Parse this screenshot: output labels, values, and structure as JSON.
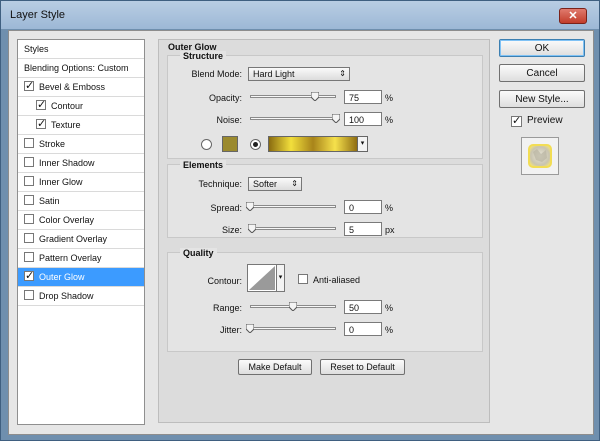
{
  "window": {
    "title": "Layer Style",
    "close_glyph": "✕"
  },
  "styles_list": {
    "items": [
      {
        "label": "Styles",
        "checkbox": false,
        "checked": false,
        "indent": false,
        "selected": false
      },
      {
        "label": "Blending Options: Custom",
        "checkbox": false,
        "checked": false,
        "indent": false,
        "selected": false
      },
      {
        "label": "Bevel & Emboss",
        "checkbox": true,
        "checked": true,
        "indent": false,
        "selected": false
      },
      {
        "label": "Contour",
        "checkbox": true,
        "checked": true,
        "indent": true,
        "selected": false
      },
      {
        "label": "Texture",
        "checkbox": true,
        "checked": true,
        "indent": true,
        "selected": false
      },
      {
        "label": "Stroke",
        "checkbox": true,
        "checked": false,
        "indent": false,
        "selected": false
      },
      {
        "label": "Inner Shadow",
        "checkbox": true,
        "checked": false,
        "indent": false,
        "selected": false
      },
      {
        "label": "Inner Glow",
        "checkbox": true,
        "checked": false,
        "indent": false,
        "selected": false
      },
      {
        "label": "Satin",
        "checkbox": true,
        "checked": false,
        "indent": false,
        "selected": false
      },
      {
        "label": "Color Overlay",
        "checkbox": true,
        "checked": false,
        "indent": false,
        "selected": false
      },
      {
        "label": "Gradient Overlay",
        "checkbox": true,
        "checked": false,
        "indent": false,
        "selected": false
      },
      {
        "label": "Pattern Overlay",
        "checkbox": true,
        "checked": false,
        "indent": false,
        "selected": false
      },
      {
        "label": "Outer Glow",
        "checkbox": true,
        "checked": true,
        "indent": false,
        "selected": true
      },
      {
        "label": "Drop Shadow",
        "checkbox": true,
        "checked": false,
        "indent": false,
        "selected": false
      }
    ]
  },
  "outer_glow": {
    "title": "Outer Glow",
    "structure": {
      "title": "Structure",
      "blend_mode_label": "Blend Mode:",
      "blend_mode_value": "Hard Light",
      "opacity_label": "Opacity:",
      "opacity_value": "75",
      "opacity_unit": "%",
      "opacity_fraction": 0.75,
      "noise_label": "Noise:",
      "noise_value": "100",
      "noise_unit": "%",
      "noise_fraction": 1.0,
      "solid_color": "#9b8a2e",
      "gradient_colors": [
        "#8a6b10",
        "#f2df3c",
        "#a8841a",
        "#f6e14c",
        "#8f6d12"
      ]
    },
    "elements": {
      "title": "Elements",
      "technique_label": "Technique:",
      "technique_value": "Softer",
      "spread_label": "Spread:",
      "spread_value": "0",
      "spread_unit": "%",
      "spread_fraction": 0,
      "size_label": "Size:",
      "size_value": "5",
      "size_unit": "px",
      "size_fraction": 0.02
    },
    "quality": {
      "title": "Quality",
      "contour_label": "Contour:",
      "anti_aliased_label": "Anti-aliased",
      "anti_aliased_checked": false,
      "range_label": "Range:",
      "range_value": "50",
      "range_unit": "%",
      "range_fraction": 0.5,
      "jitter_label": "Jitter:",
      "jitter_value": "0",
      "jitter_unit": "%",
      "jitter_fraction": 0
    },
    "make_default_label": "Make Default",
    "reset_default_label": "Reset to Default"
  },
  "actions": {
    "ok_label": "OK",
    "cancel_label": "Cancel",
    "new_style_label": "New Style...",
    "preview_label": "Preview",
    "preview_checked": true
  },
  "colors": {
    "selected_row": "#3c9bff",
    "dialog_bg": "#e6e6e6",
    "title_bar": "#b9cde3"
  }
}
